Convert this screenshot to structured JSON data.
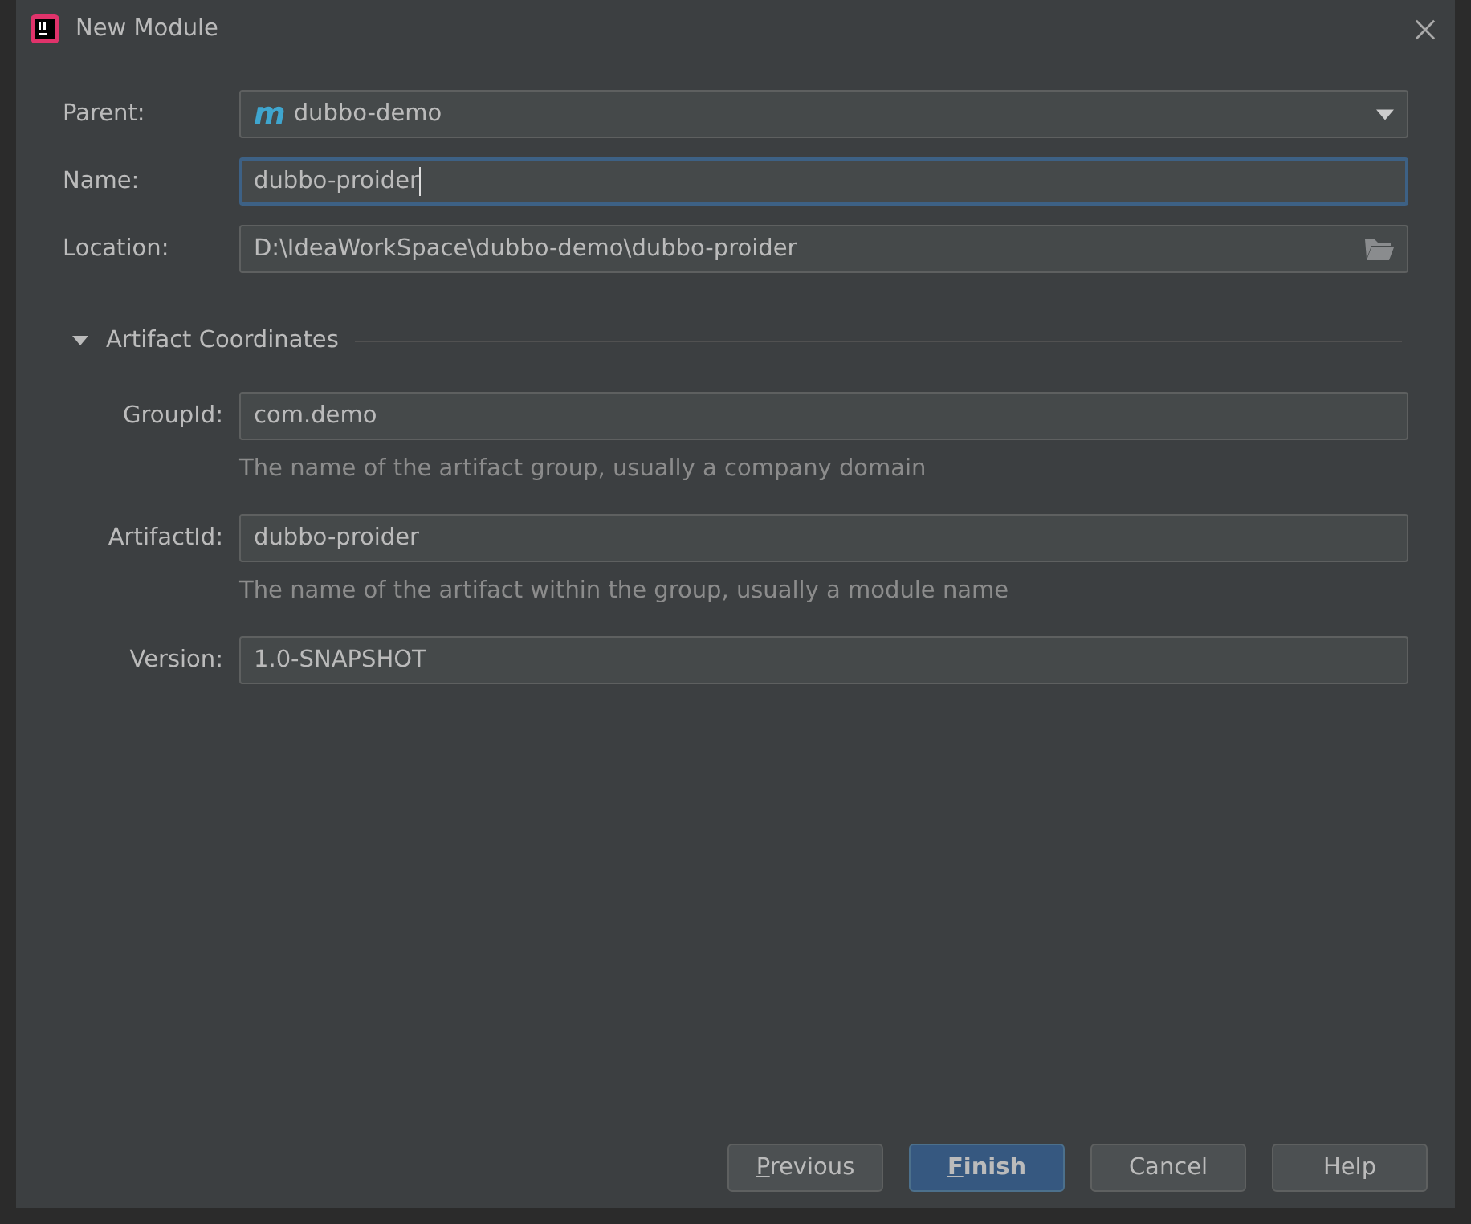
{
  "window": {
    "title": "New Module"
  },
  "fields": [
    {
      "label": "Parent:",
      "value": "dubbo-demo",
      "icon": "m",
      "kind": "dropdown",
      "focused": false
    },
    {
      "label": "Name:",
      "value": "dubbo-proider",
      "kind": "text",
      "focused": true
    },
    {
      "label": "Location:",
      "value": "D:\\IdeaWorkSpace\\dubbo-demo\\dubbo-proider",
      "kind": "browse",
      "focused": false
    }
  ],
  "section": {
    "title": "Artifact Coordinates",
    "expanded": true,
    "fields": [
      {
        "label": "GroupId:",
        "value": "com.demo",
        "hint": "The name of the artifact group, usually a company domain"
      },
      {
        "label": "ArtifactId:",
        "value": "dubbo-proider",
        "hint": "The name of the artifact within the group, usually a module name"
      },
      {
        "label": "Version:",
        "value": "1.0-SNAPSHOT"
      }
    ]
  },
  "buttons": [
    {
      "label": "Previous",
      "default": false,
      "mnemonic": true
    },
    {
      "label": "Finish",
      "default": true,
      "mnemonic": true
    },
    {
      "label": "Cancel",
      "default": false,
      "mnemonic": false
    },
    {
      "label": "Help",
      "default": false,
      "mnemonic": false
    }
  ]
}
